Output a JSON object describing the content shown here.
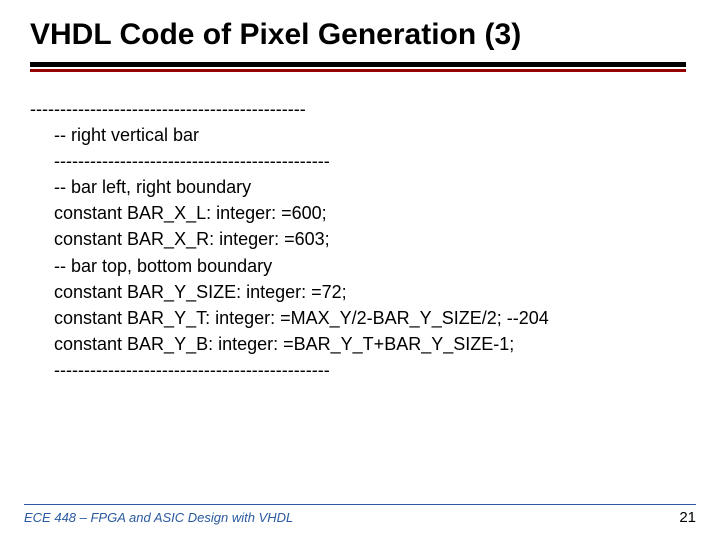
{
  "title": "VHDL Code of Pixel Generation (3)",
  "code": {
    "dash0": "----------------------------------------------",
    "line0": "-- right vertical bar",
    "dash1": "----------------------------------------------",
    "line1": "-- bar left, right boundary",
    "line2": "constant BAR_X_L: integer: =600;",
    "line3": "constant BAR_X_R: integer: =603;",
    "line4": "-- bar top, bottom boundary",
    "line5": "constant BAR_Y_SIZE: integer: =72;",
    "line6": "constant BAR_Y_T: integer: =MAX_Y/2-BAR_Y_SIZE/2; --204",
    "line7": "constant BAR_Y_B: integer: =BAR_Y_T+BAR_Y_SIZE-1;",
    "dash2": "----------------------------------------------"
  },
  "footer": {
    "course": "ECE 448 – FPGA and ASIC Design with VHDL",
    "page": "21"
  }
}
